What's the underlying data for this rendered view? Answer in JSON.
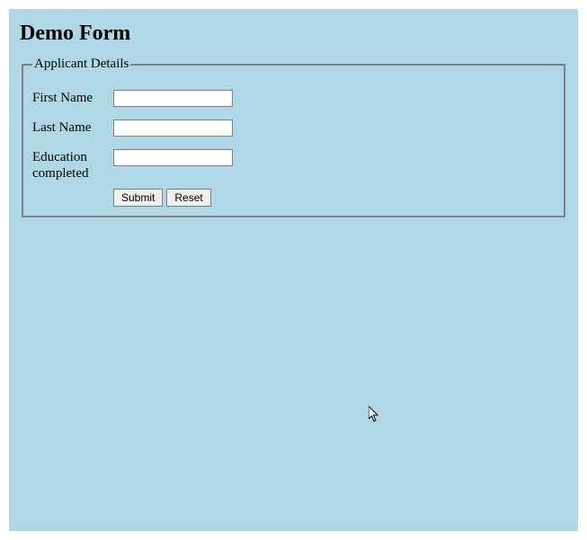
{
  "heading": "Demo Form",
  "fieldset": {
    "legend": "Applicant Details",
    "fields": {
      "first_name": {
        "label": "First Name",
        "value": ""
      },
      "last_name": {
        "label": "Last Name",
        "value": ""
      },
      "education": {
        "label": "Education completed",
        "value": ""
      }
    },
    "buttons": {
      "submit": "Submit",
      "reset": "Reset"
    }
  }
}
